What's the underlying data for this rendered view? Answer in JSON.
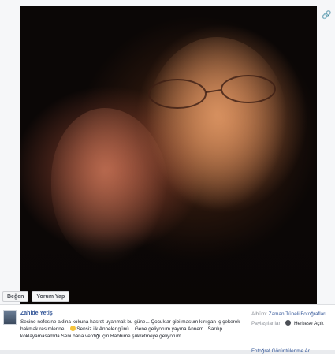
{
  "photo_viewer": {
    "share_icon": "link-icon",
    "actions": {
      "like_label": "Beğen",
      "comment_label": "Yorum Yap"
    }
  },
  "post": {
    "author": "Zahide Yetiş",
    "caption_part1": "Sesine nefesine aklina kokuna hasret uyanmak bu güne... Çocuklar gibi masum kırılgan iç çekerek bakmak resimlerine...",
    "emoji": "smile-emoji",
    "caption_part2": "Sensiz ilk Anneler günü ...Gene geliyorum yayına Annem...Sarılıp koklayamasamda Seni bana verdiği için Rabbime şükretmeye geliyorum..."
  },
  "sidebar": {
    "album_label": "Albüm:",
    "album_name": "Zaman Tüneli Fotoğrafları",
    "sharing_label": "Paylaşılanlar:",
    "sharing_value": "Herkese Açık",
    "truncated_link": "Fotoğraf Görüntülenme Ar..."
  }
}
